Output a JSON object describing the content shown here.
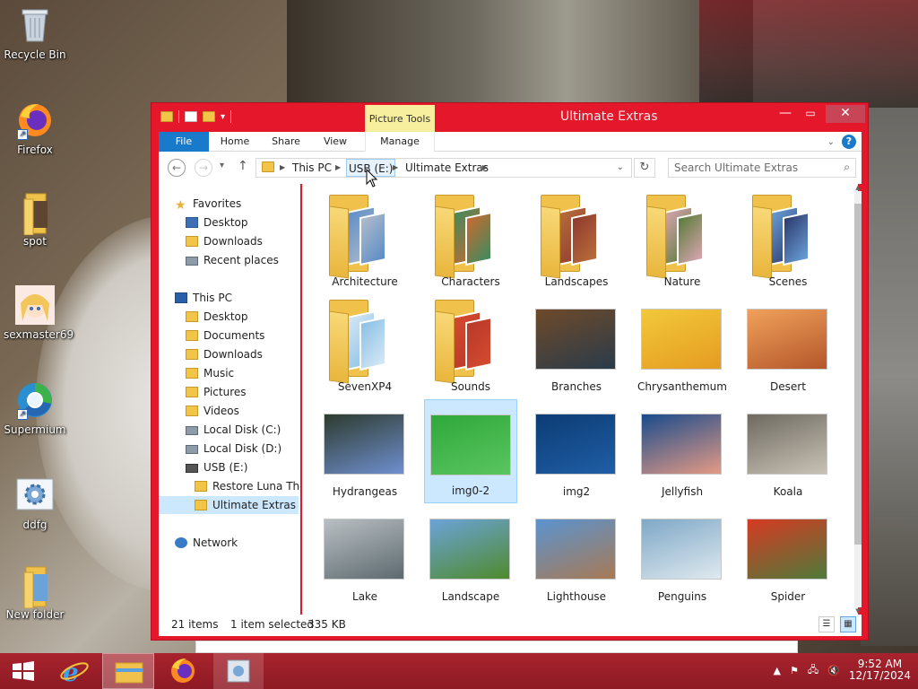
{
  "desktop": {
    "icons": [
      {
        "label": "Recycle Bin"
      },
      {
        "label": "Firefox"
      },
      {
        "label": "spot"
      },
      {
        "label": "sexmaster69"
      },
      {
        "label": "Supermium"
      },
      {
        "label": "ddfg"
      },
      {
        "label": "New folder"
      }
    ]
  },
  "window": {
    "title": "Ultimate Extras",
    "context_tab": "Picture Tools",
    "ribbon_tabs": [
      "File",
      "Home",
      "Share",
      "View",
      "Manage"
    ],
    "breadcrumbs": [
      "This PC",
      "USB (E:)",
      "Ultimate Extras"
    ],
    "search_placeholder": "Search Ultimate Extras",
    "nav": {
      "favorites_header": "Favorites",
      "favorites": [
        "Desktop",
        "Downloads",
        "Recent places"
      ],
      "thispc_header": "This PC",
      "thispc": [
        "Desktop",
        "Documents",
        "Downloads",
        "Music",
        "Pictures",
        "Videos",
        "Local Disk (C:)",
        "Local Disk (D:)",
        "USB (E:)"
      ],
      "usb_children": [
        "Restore Luna Ther",
        "Ultimate Extras"
      ],
      "network": "Network"
    },
    "items": [
      {
        "name": "Architecture",
        "kind": "folder",
        "colors": [
          "#5b8cc6",
          "#b0bccb"
        ]
      },
      {
        "name": "Characters",
        "kind": "folder",
        "colors": [
          "#3d8b5f",
          "#c86a2f"
        ]
      },
      {
        "name": "Landscapes",
        "kind": "folder",
        "colors": [
          "#b86e3b",
          "#8f3a2e"
        ]
      },
      {
        "name": "Nature",
        "kind": "folder",
        "colors": [
          "#d8a5b0",
          "#5a7b3a"
        ]
      },
      {
        "name": "Scenes",
        "kind": "folder",
        "colors": [
          "#6aa0d8",
          "#2c3a6e"
        ]
      },
      {
        "name": "SevenXP4",
        "kind": "folder",
        "colors": [
          "#d6e8f5",
          "#8bc0e6"
        ]
      },
      {
        "name": "Sounds",
        "kind": "folder",
        "colors": [
          "#d44a2f",
          "#b9392a"
        ]
      },
      {
        "name": "Branches",
        "kind": "image",
        "colors": [
          "#6e4a2a",
          "#2a3b4a"
        ]
      },
      {
        "name": "Chrysanthemum",
        "kind": "image",
        "colors": [
          "#f2c83a",
          "#e59c21"
        ]
      },
      {
        "name": "Desert",
        "kind": "image",
        "colors": [
          "#f0a15b",
          "#b4562a"
        ]
      },
      {
        "name": "Hydrangeas",
        "kind": "image",
        "colors": [
          "#2d3b2e",
          "#6f8fcf"
        ]
      },
      {
        "name": "img0-2",
        "kind": "image",
        "colors": [
          "#2fa83a",
          "#5ac560"
        ]
      },
      {
        "name": "img2",
        "kind": "image",
        "colors": [
          "#0c3c74",
          "#1f5ea6"
        ]
      },
      {
        "name": "Jellyfish",
        "kind": "image",
        "colors": [
          "#1a4b8c",
          "#e49a85"
        ]
      },
      {
        "name": "Koala",
        "kind": "image",
        "colors": [
          "#6f6a60",
          "#c8c2b6"
        ]
      },
      {
        "name": "Lake",
        "kind": "image",
        "colors": [
          "#b9bfc3",
          "#5d6a70"
        ]
      },
      {
        "name": "Landscape",
        "kind": "image",
        "colors": [
          "#6ba3d8",
          "#4f8a2d"
        ]
      },
      {
        "name": "Lighthouse",
        "kind": "image",
        "colors": [
          "#5b93cf",
          "#a77a55"
        ]
      },
      {
        "name": "Penguins",
        "kind": "image",
        "colors": [
          "#7fa8c7",
          "#dfe9ef"
        ]
      },
      {
        "name": "Spider",
        "kind": "image",
        "colors": [
          "#d63a22",
          "#4f7a3a"
        ]
      }
    ],
    "status": {
      "count": "21 items",
      "selected": "1 item selected",
      "size": "335 KB"
    }
  },
  "tray": {
    "time": "9:52 AM",
    "date": "12/17/2024"
  },
  "accent": "#e5172a"
}
